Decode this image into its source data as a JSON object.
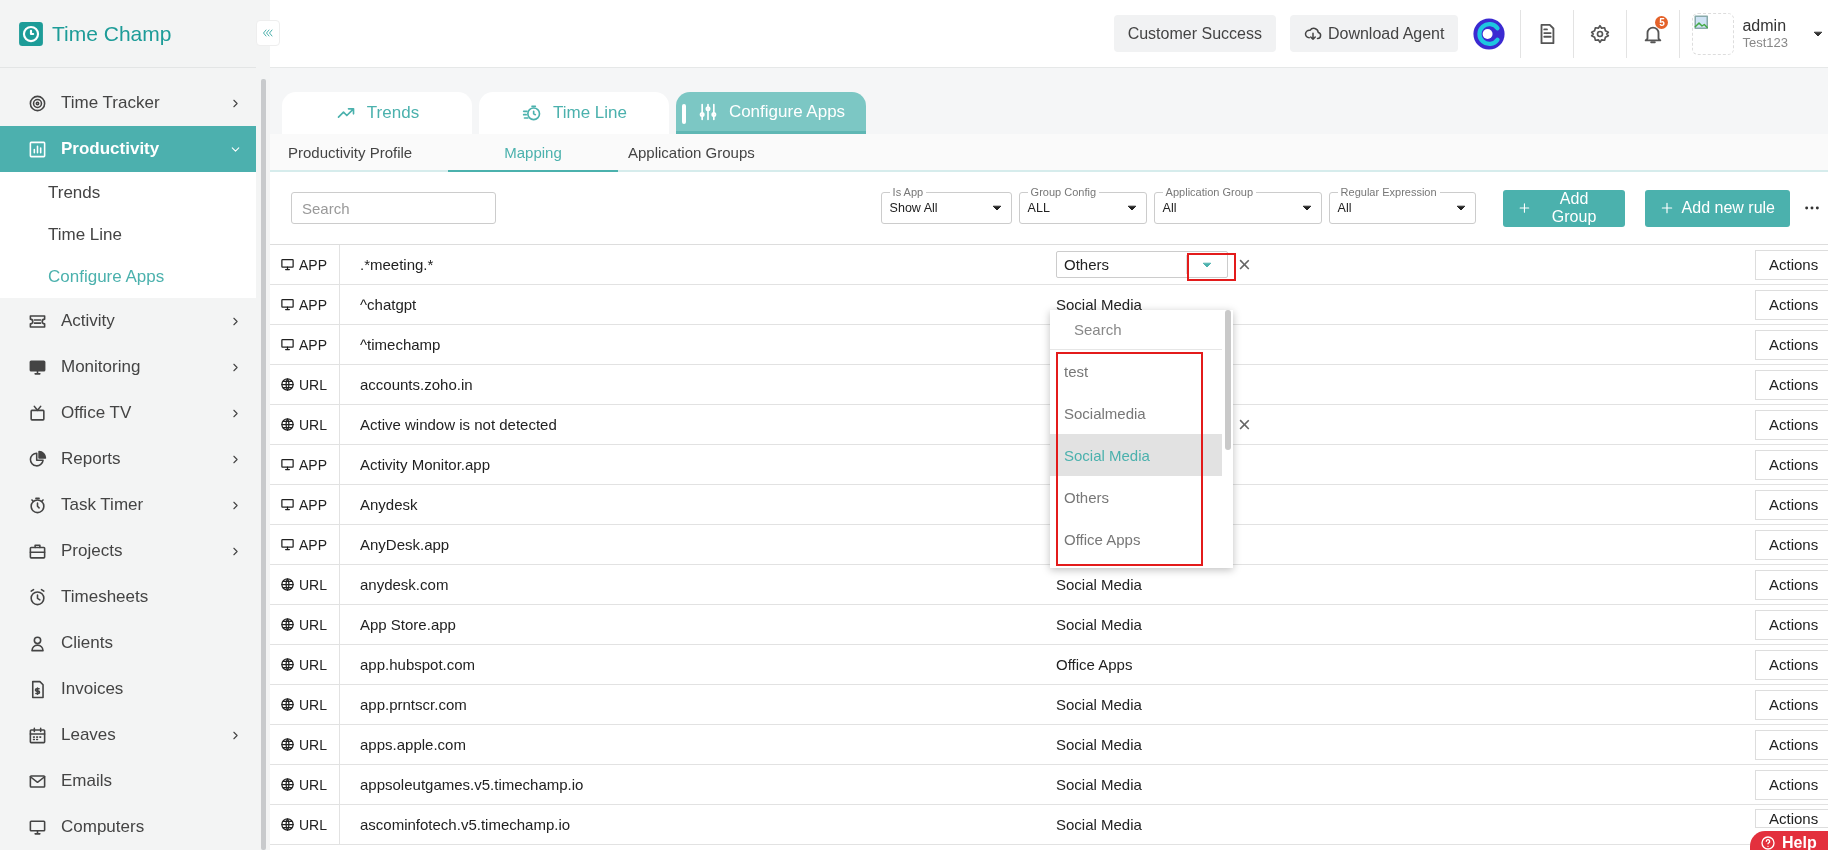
{
  "brand": {
    "name": "Time Champ"
  },
  "sidebar": {
    "items": [
      {
        "label": "Time Tracker",
        "selected": false,
        "expandable": true,
        "expanded": false
      },
      {
        "label": "Productivity",
        "selected": true,
        "expandable": true,
        "expanded": true,
        "children": [
          {
            "label": "Trends",
            "selected": false
          },
          {
            "label": "Time Line",
            "selected": false
          },
          {
            "label": "Configure Apps",
            "selected": true
          }
        ]
      },
      {
        "label": "Activity",
        "selected": false,
        "expandable": true,
        "expanded": false
      },
      {
        "label": "Monitoring",
        "selected": false,
        "expandable": true,
        "expanded": false
      },
      {
        "label": "Office TV",
        "selected": false,
        "expandable": true,
        "expanded": false
      },
      {
        "label": "Reports",
        "selected": false,
        "expandable": true,
        "expanded": false
      },
      {
        "label": "Task Timer",
        "selected": false,
        "expandable": true,
        "expanded": false
      },
      {
        "label": "Projects",
        "selected": false,
        "expandable": true,
        "expanded": false
      },
      {
        "label": "Timesheets",
        "selected": false,
        "expandable": false
      },
      {
        "label": "Clients",
        "selected": false,
        "expandable": false
      },
      {
        "label": "Invoices",
        "selected": false,
        "expandable": false
      },
      {
        "label": "Leaves",
        "selected": false,
        "expandable": true,
        "expanded": false
      },
      {
        "label": "Emails",
        "selected": false,
        "expandable": false
      },
      {
        "label": "Computers",
        "selected": false,
        "expandable": false
      }
    ]
  },
  "topbar": {
    "buttons": [
      "Customer Success",
      "Download Agent"
    ],
    "notification_count": "5",
    "user": {
      "name": "admin",
      "org": "Test123"
    }
  },
  "tabs": [
    {
      "label": "Trends",
      "selected": false
    },
    {
      "label": "Time Line",
      "selected": false
    },
    {
      "label": "Configure Apps",
      "selected": true
    }
  ],
  "subtabs": [
    {
      "label": "Productivity Profile",
      "selected": false
    },
    {
      "label": "Mapping",
      "selected": true
    },
    {
      "label": "Application Groups",
      "selected": false
    }
  ],
  "filters": {
    "search": {
      "placeholder": "Search"
    },
    "selects": [
      {
        "label": "Is App",
        "value": "Show All"
      },
      {
        "label": "Group Config",
        "value": "ALL"
      },
      {
        "label": "Application Group",
        "value": "All"
      },
      {
        "label": "Regular Expression",
        "value": "All"
      }
    ],
    "buttons": [
      "Add Group",
      "Add new rule"
    ]
  },
  "rows": [
    {
      "kind": "app",
      "type": "APP",
      "name": ".*meeting.*",
      "group": "Others",
      "editing": true,
      "clear": "×",
      "action": "Actions"
    },
    {
      "kind": "app",
      "type": "APP",
      "name": "^chatgpt",
      "group": "Social Media",
      "action": "Actions"
    },
    {
      "kind": "app",
      "type": "APP",
      "name": "^timechamp",
      "action": "Actions"
    },
    {
      "kind": "url",
      "type": "URL",
      "name": "accounts.zoho.in",
      "action": "Actions"
    },
    {
      "kind": "url",
      "type": "URL",
      "name": "Active window is not detected",
      "clear": "×",
      "action": "Actions"
    },
    {
      "kind": "app",
      "type": "APP",
      "name": "Activity Monitor.app",
      "action": "Actions"
    },
    {
      "kind": "app",
      "type": "APP",
      "name": "Anydesk",
      "action": "Actions"
    },
    {
      "kind": "app",
      "type": "APP",
      "name": "AnyDesk.app",
      "action": "Actions"
    },
    {
      "kind": "url",
      "type": "URL",
      "name": "anydesk.com",
      "group": "Social Media",
      "action": "Actions"
    },
    {
      "kind": "url",
      "type": "URL",
      "name": "App Store.app",
      "group": "Social Media",
      "action": "Actions"
    },
    {
      "kind": "url",
      "type": "URL",
      "name": "app.hubspot.com",
      "group": "Office Apps",
      "action": "Actions"
    },
    {
      "kind": "url",
      "type": "URL",
      "name": "app.prntscr.com",
      "group": "Social Media",
      "action": "Actions"
    },
    {
      "kind": "url",
      "type": "URL",
      "name": "apps.apple.com",
      "group": "Social Media",
      "action": "Actions"
    },
    {
      "kind": "url",
      "type": "URL",
      "name": "appsoleutgames.v5.timechamp.io",
      "group": "Social Media",
      "action": "Actions"
    },
    {
      "kind": "url",
      "type": "URL",
      "name": "ascominfotech.v5.timechamp.io",
      "group": "Social Media",
      "action": "Actions"
    }
  ],
  "dropdown": {
    "search_placeholder": "Search",
    "options": [
      {
        "label": "test",
        "selected": false
      },
      {
        "label": "Socialmedia",
        "selected": false
      },
      {
        "label": "Social Media",
        "selected": true
      },
      {
        "label": "Others",
        "selected": false
      },
      {
        "label": "Office Apps",
        "selected": false
      }
    ]
  },
  "help": {
    "label": "Help"
  }
}
